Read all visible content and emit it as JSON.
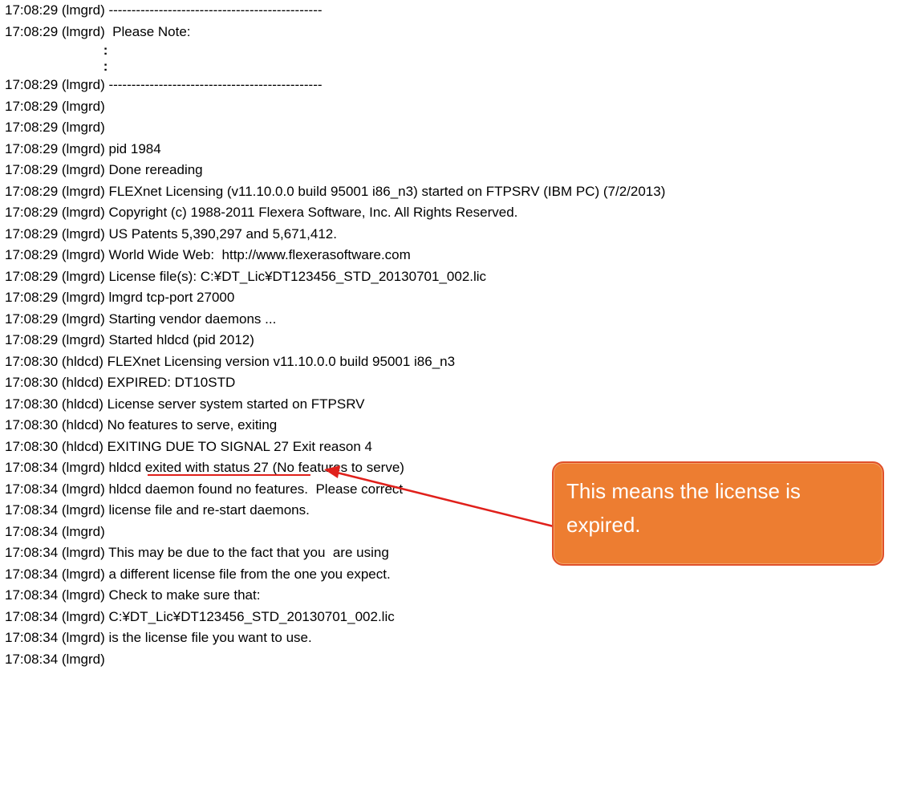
{
  "log_lines": [
    "17:08:29 (lmgrd) -----------------------------------------------",
    "17:08:29 (lmgrd)  Please Note:",
    "                          :",
    "                          :",
    "17:08:29 (lmgrd) -----------------------------------------------",
    "17:08:29 (lmgrd)",
    "17:08:29 (lmgrd)",
    "17:08:29 (lmgrd) pid 1984",
    "17:08:29 (lmgrd) Done rereading",
    "17:08:29 (lmgrd) FLEXnet Licensing (v11.10.0.0 build 95001 i86_n3) started on FTPSRV (IBM PC) (7/2/2013)",
    "17:08:29 (lmgrd) Copyright (c) 1988-2011 Flexera Software, Inc. All Rights Reserved.",
    "17:08:29 (lmgrd) US Patents 5,390,297 and 5,671,412.",
    "17:08:29 (lmgrd) World Wide Web:  http://www.flexerasoftware.com",
    "17:08:29 (lmgrd) License file(s): C:¥DT_Lic¥DT123456_STD_20130701_002.lic",
    "17:08:29 (lmgrd) lmgrd tcp-port 27000",
    "17:08:29 (lmgrd) Starting vendor daemons ...",
    "17:08:29 (lmgrd) Started hldcd (pid 2012)",
    "17:08:30 (hldcd) FLEXnet Licensing version v11.10.0.0 build 95001 i86_n3",
    "17:08:30 (hldcd) EXPIRED: DT10STD",
    "17:08:30 (hldcd) License server system started on FTPSRV",
    "17:08:30 (hldcd) No features to serve, exiting",
    "17:08:30 (hldcd) EXITING DUE TO SIGNAL 27 Exit reason 4",
    "17:08:34 (lmgrd) hldcd exited with status 27 (No features to serve)",
    "17:08:34 (lmgrd) hldcd daemon found no features.  Please correct",
    "17:08:34 (lmgrd) license file and re-start daemons.",
    "17:08:34 (lmgrd)",
    "17:08:34 (lmgrd) This may be due to the fact that you  are using",
    "17:08:34 (lmgrd) a different license file from the one you expect.",
    "17:08:34 (lmgrd) Check to make sure that:",
    "17:08:34 (lmgrd) C:¥DT_Lic¥DT123456_STD_20130701_002.lic",
    "17:08:34 (lmgrd) is the license file you want to use.",
    "17:08:34 (lmgrd)"
  ],
  "callout": {
    "text": "This means the license is expired."
  },
  "colors": {
    "callout_fill": "#ed7d31",
    "arrow_red": "#e0201b"
  }
}
